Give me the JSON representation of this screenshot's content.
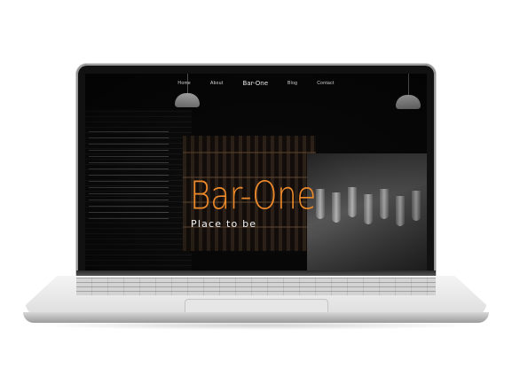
{
  "site": {
    "nav": {
      "items": [
        {
          "label": "Home"
        },
        {
          "label": "About"
        },
        {
          "label": "Bar-One",
          "is_brand": true
        },
        {
          "label": "Blog"
        },
        {
          "label": "Contact"
        }
      ]
    },
    "hero": {
      "title": "Bar-One",
      "subtitle": "Place to be"
    }
  },
  "colors": {
    "accent": "#ee8a2a",
    "background": "#080808",
    "nav_text": "#d8d8d8"
  }
}
